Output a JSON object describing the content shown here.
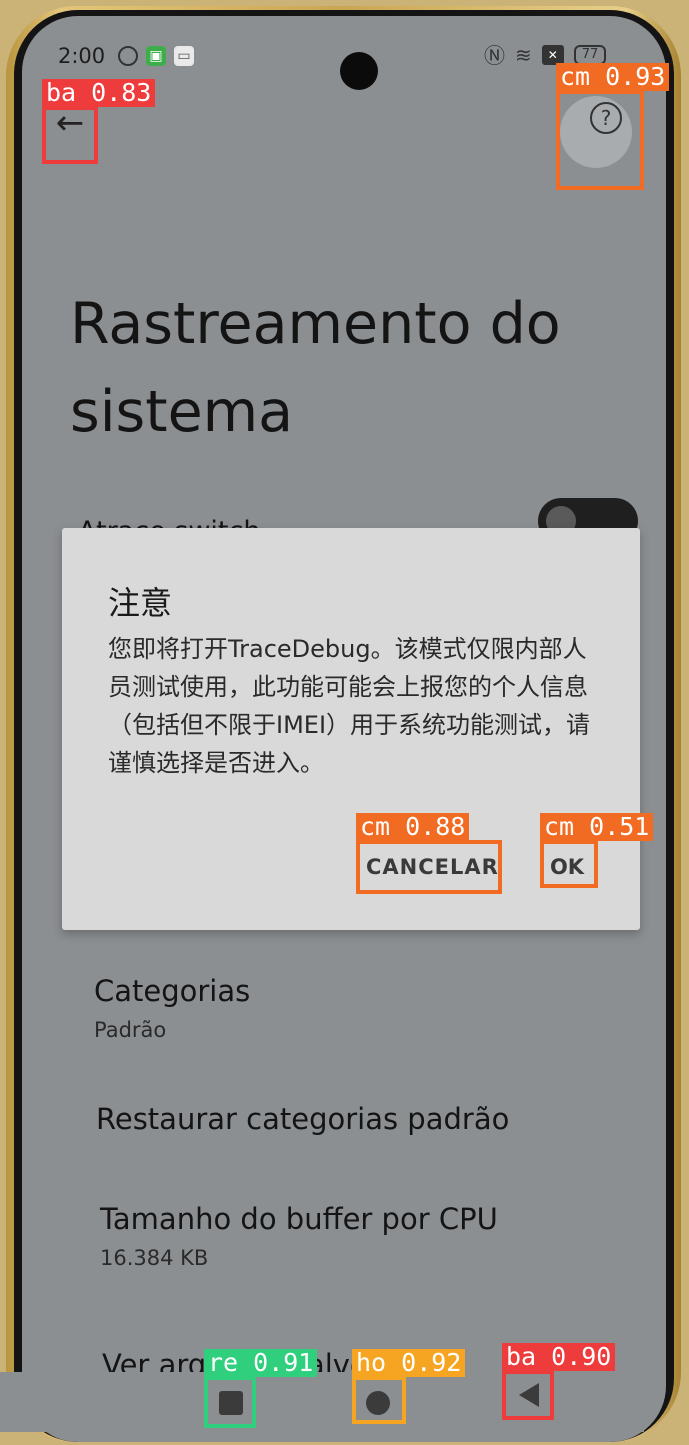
{
  "status_bar": {
    "time": "2:00",
    "battery": "77",
    "nfc_icon": "nfc-icon",
    "wifi_icon": "wifi-icon"
  },
  "page": {
    "title": "Rastreamento do sistema",
    "atrace_label": "Atrace switch"
  },
  "dialog": {
    "title": "注意",
    "message": "您即将打开TraceDebug。该模式仅限内部人员测试使用，此功能可能会上报您的个人信息（包括但不限于IMEI）用于系统功能测试，请谨慎选择是否进入。",
    "cancel_label": "CANCELAR",
    "ok_label": "OK"
  },
  "settings": [
    {
      "title": "Categorias",
      "subtitle": "Padrão"
    },
    {
      "title": "Restaurar categorias padrão",
      "subtitle": ""
    },
    {
      "title": "Tamanho do buffer por CPU",
      "subtitle": "16.384 KB"
    },
    {
      "title": "Ver arquivos salvos",
      "subtitle": ""
    }
  ],
  "detections": [
    {
      "label": "ba 0.83",
      "color": "#ee3b3b"
    },
    {
      "label": "cm 0.93",
      "color": "#f26b22"
    },
    {
      "label": "cm 0.88",
      "color": "#f26b22"
    },
    {
      "label": "cm 0.51",
      "color": "#f26b22"
    },
    {
      "label": "re 0.91",
      "color": "#2fcf7d"
    },
    {
      "label": "ho 0.92",
      "color": "#f6a523"
    },
    {
      "label": "ba 0.90",
      "color": "#ee3b3b"
    }
  ]
}
